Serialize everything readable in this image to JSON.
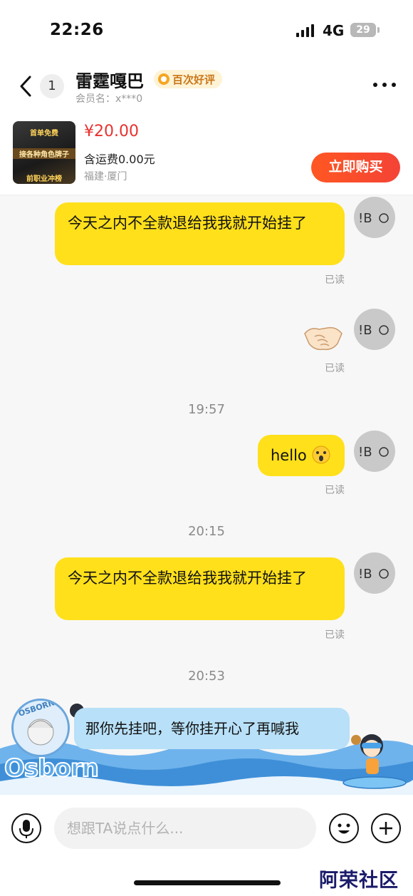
{
  "status_bar": {
    "time": "22:26",
    "network": "4G",
    "battery": "29"
  },
  "header": {
    "unread_count": "1",
    "seller_name": "雷霆嘎巴",
    "badge": "百次好评",
    "member_label": "会员名：x***0"
  },
  "product": {
    "thumb_lines": [
      "首单免费",
      "接各种角色牌子",
      "前职业冲榜"
    ],
    "price": "¥20.00",
    "shipping": "含运费0.00元",
    "location": "福建·厦门",
    "buy_label": "立即购买"
  },
  "avatar_text": "!B",
  "messages": [
    {
      "text": "今天之内不全款退给我我就开始挂了",
      "status": "已读"
    },
    {
      "status": "已读"
    },
    {
      "time": "19:57",
      "text": "hello",
      "status": "已读"
    },
    {
      "time": "20:15",
      "text": "今天之内不全款退给我我就开始挂了",
      "status": "已读"
    },
    {
      "time": "20:53",
      "text": "那你先挂吧，等你挂开心了再喊我"
    }
  ],
  "decor": {
    "badge_text": "OSBORN",
    "brand_text": "Osborn"
  },
  "input": {
    "placeholder": "想跟TA说点什么..."
  },
  "watermark": "阿荣社区"
}
